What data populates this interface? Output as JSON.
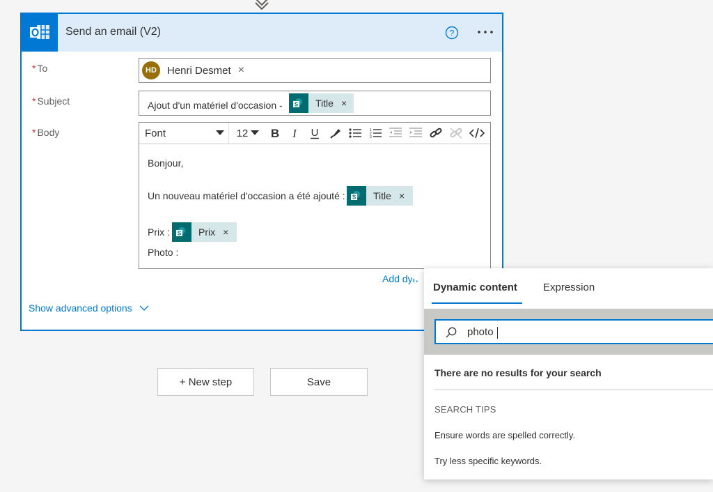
{
  "card": {
    "title": "Send an email (V2)"
  },
  "fields": {
    "required_mark": "*",
    "to_label": "To",
    "subject_label": "Subject",
    "body_label": "Body"
  },
  "to": {
    "avatar_initials": "HD",
    "avatar_color": "#986f0b",
    "name": "Henri Desmet",
    "remove": "×"
  },
  "subject": {
    "text": "Ajout d'un matériel d'occasion -",
    "token_label": "Title",
    "token_remove": "×"
  },
  "editor": {
    "font_select": "Font",
    "size_select": "12",
    "tools": [
      "bold",
      "italic",
      "underline",
      "highlight",
      "bullet-list",
      "numbered-list",
      "decrease-indent",
      "increase-indent",
      "link",
      "unlink",
      "code-view"
    ],
    "greeting": "Bonjour,",
    "line1": "Un nouveau matériel d'occasion a été ajouté :",
    "line1_token": "Title",
    "line2": "Prix :",
    "line2_token": "Prix",
    "line3": "Photo :",
    "token_remove": "×"
  },
  "links": {
    "add_dynamic": "Add dyn",
    "show_advanced": "Show advanced options"
  },
  "buttons": {
    "new_step": "+ New step",
    "save": "Save"
  },
  "dynamic_panel": {
    "tabs": [
      "Dynamic content",
      "Expression"
    ],
    "active_tab": "Dynamic content",
    "search_value": "photo",
    "no_results": "There are no results for your search",
    "tips_heading": "SEARCH TIPS",
    "tips": [
      "Ensure words are spelled correctly.",
      "Try less specific keywords."
    ]
  },
  "colors": {
    "accent": "#0078d4",
    "header_bg": "#deecf9",
    "sharepoint_teal": "#036c70",
    "token_bg": "#d5e7e8",
    "required": "#d13438"
  }
}
